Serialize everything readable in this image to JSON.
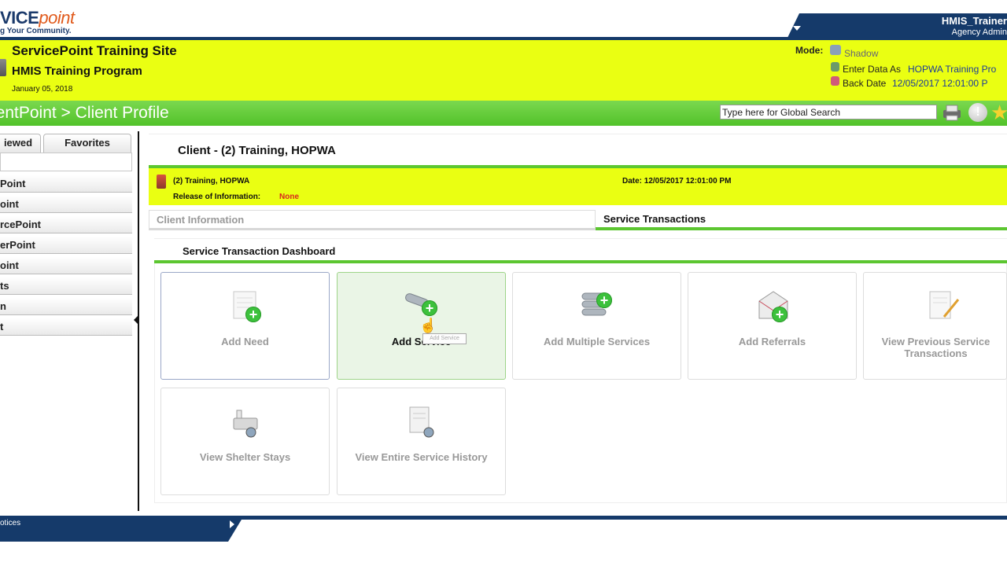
{
  "brand": {
    "logo_text": "VICEpoint",
    "logo_prefix": "VICE",
    "logo_accent": "point",
    "tagline": "g Your Community."
  },
  "user": {
    "name": "HMIS_Trainer",
    "role": "Agency Admin"
  },
  "site": {
    "title": "ServicePoint Training Site",
    "program": "HMIS Training Program",
    "date": "January 05, 2018",
    "mode_label": "Mode:",
    "mode_value": "Shadow",
    "enter_data_label": "Enter Data As",
    "enter_data_value": "HOPWA Training Pro",
    "back_date_label": "Back Date",
    "back_date_value": "12/05/2017 12:01:00 P"
  },
  "breadcrumb": "ientPoint > Client Profile",
  "global_search": {
    "placeholder": "Type here for Global Search",
    "value": "Type here for Global Search"
  },
  "sidebar": {
    "tabs": [
      "iewed",
      "Favorites"
    ],
    "items": [
      "Point",
      "oint",
      "rcePoint",
      "erPoint",
      "oint",
      "ts",
      "n",
      "t"
    ]
  },
  "client": {
    "heading": "Client - (2) Training, HOPWA",
    "name": "(2) Training, HOPWA",
    "roi_label": "Release of Information:",
    "roi_value": "None",
    "date": "Date: 12/05/2017 12:01:00 PM"
  },
  "tabs": {
    "client_information": "Client Information",
    "service_transactions": "Service Transactions"
  },
  "dashboard": {
    "title": "Service Transaction Dashboard",
    "tiles": [
      {
        "label": "Add Need",
        "icon": "add-need-icon"
      },
      {
        "label": "Add Service",
        "icon": "add-service-icon",
        "tooltip": "Add Service"
      },
      {
        "label": "Add Multiple Services",
        "icon": "add-multiple-services-icon"
      },
      {
        "label": "Add Referrals",
        "icon": "add-referrals-icon"
      },
      {
        "label": "View Previous Service Transactions",
        "icon": "view-previous-transactions-icon"
      },
      {
        "label": "View Shelter Stays",
        "icon": "view-shelter-stays-icon"
      },
      {
        "label": "View Entire Service History",
        "icon": "view-service-history-icon"
      }
    ]
  },
  "footer": {
    "notices": "otices"
  },
  "colors": {
    "navy": "#153a6a",
    "yellow": "#eaff12",
    "green": "#5cc630",
    "alert_red": "#d8281e"
  }
}
